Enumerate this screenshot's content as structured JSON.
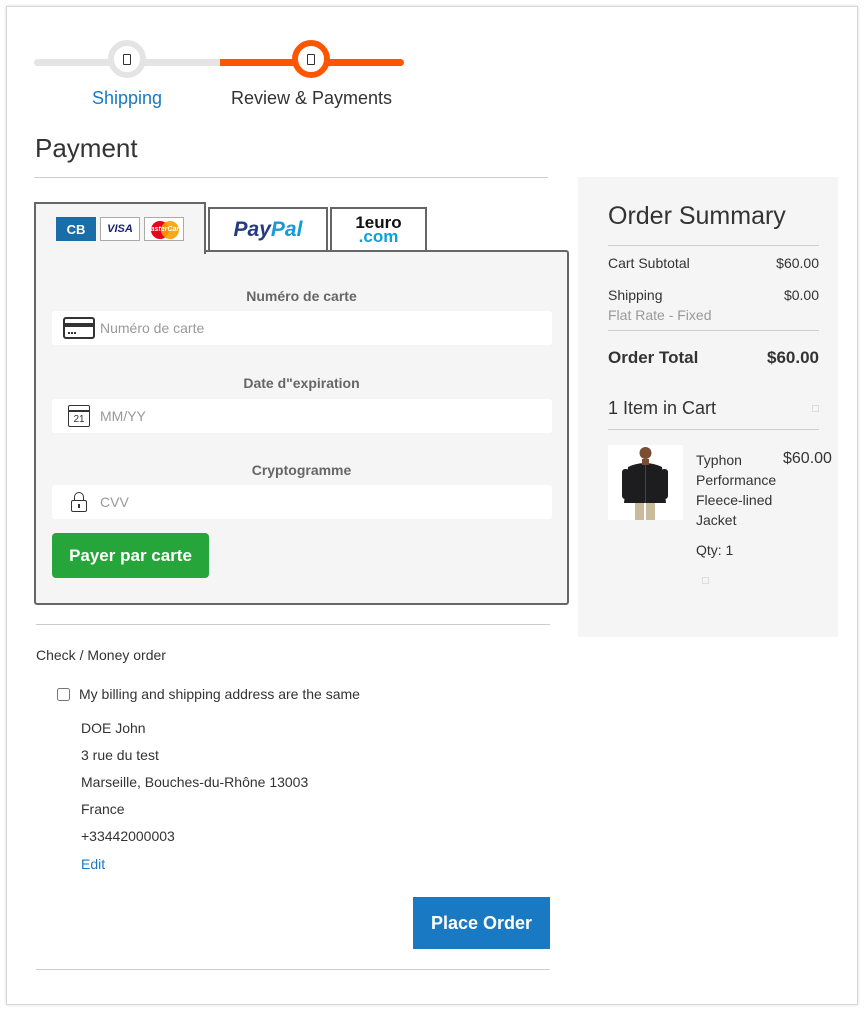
{
  "progress": {
    "steps": [
      {
        "label": "Shipping"
      },
      {
        "label": "Review & Payments"
      }
    ]
  },
  "payment": {
    "title": "Payment",
    "tabs": {
      "cards": {
        "cb": "CB",
        "visa": "VISA",
        "mastercard": "MasterCard"
      },
      "paypal": {
        "part1": "Pay",
        "part2": "Pal"
      },
      "euro": {
        "top": "1euro",
        "bottom": ".com"
      }
    },
    "card_form": {
      "number_label": "Numéro de carte",
      "number_placeholder": "Numéro de carte",
      "expiry_label": "Date d\"expiration",
      "expiry_placeholder": "MM/YY",
      "calendar_day": "21",
      "cvv_label": "Cryptogramme",
      "cvv_placeholder": "CVV",
      "pay_button": "Payer par carte"
    },
    "check_money_order": "Check / Money order",
    "billing_same": "My billing and shipping address are the same",
    "address": {
      "name": "DOE John",
      "street": "3 rue du test",
      "city": "Marseille, Bouches-du-Rhône 13003",
      "country": "France",
      "phone": "+33442000003",
      "edit": "Edit"
    },
    "place_order": "Place Order"
  },
  "summary": {
    "title": "Order Summary",
    "cart_subtotal_label": "Cart Subtotal",
    "cart_subtotal_value": "$60.00",
    "shipping_label": "Shipping",
    "shipping_value": "$0.00",
    "shipping_method": "Flat Rate - Fixed",
    "order_total_label": "Order Total",
    "order_total_value": "$60.00",
    "items_in_cart": "1 Item in Cart",
    "item": {
      "name": "Typhon Performance Fleece-lined Jacket",
      "price": "$60.00",
      "qty": "Qty: 1"
    }
  },
  "colors": {
    "accent_blue": "#1979c3",
    "progress_orange": "#ff5501",
    "pay_green": "#26a53b"
  }
}
